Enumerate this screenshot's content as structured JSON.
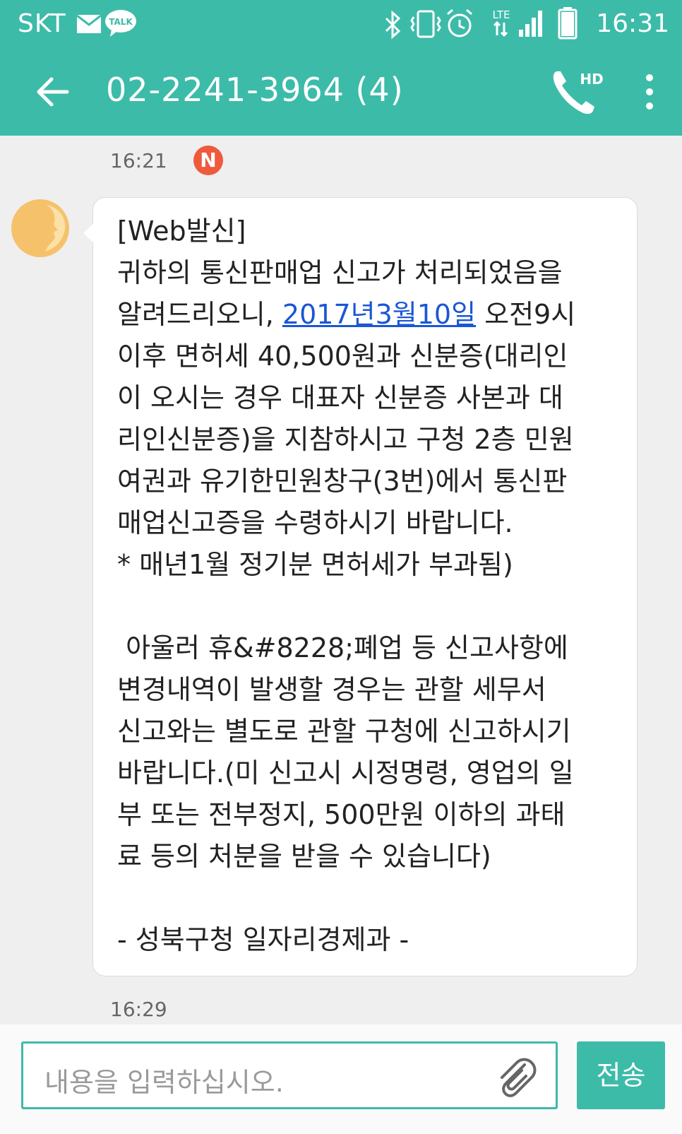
{
  "status_bar": {
    "carrier": "SKT",
    "talk_badge": "TALK",
    "network": "LTE",
    "time": "16:31",
    "icons": [
      "mail-icon",
      "talk-icon",
      "bluetooth-icon",
      "vibrate-icon",
      "alarm-icon",
      "lte-icon",
      "signal-icon",
      "battery-icon"
    ]
  },
  "app_bar": {
    "title": "02-2241-3964 (4)",
    "back_icon": "back-arrow-icon",
    "call_label": "HD",
    "call_icon": "phone-hd-icon",
    "menu_icon": "more-vert-icon"
  },
  "conversation": {
    "first_timestamp": "16:21",
    "new_badge": "N",
    "message": {
      "before_link": "[Web발신]\n귀하의 통신판매업 신고가 처리되었음을\n알려드리오니, ",
      "link_text": "2017년3월10일",
      "after_link": " 오전9시\n이후 면허세 40,500원과 신분증(대리인\n이 오시는 경우 대표자 신분증 사본과 대\n리인신분증)을 지참하시고 구청 2층 민원\n여권과 유기한민원창구(3번)에서 통신판\n매업신고증을 수령하시기 바랍니다.\n* 매년1월 정기분 면허세가 부과됨)\n\n 아울러 휴&#8228;폐업 등 신고사항에\n변경내역이 발생할 경우는 관할 세무서\n신고와는 별도로 관할 구청에 신고하시기\n바랍니다.(미 신고시 시정명령, 영업의 일\n부 또는 전부정지, 500만원 이하의 과태\n료 등의 처분을 받을 수 있습니다)\n\n- 성북구청 일자리경제과 -"
    },
    "second_timestamp": "16:29"
  },
  "composer": {
    "placeholder": "내용을 입력하십시오.",
    "attach_icon": "paperclip-icon",
    "send_label": "전송"
  },
  "colors": {
    "accent": "#3dbba9",
    "badge": "#ef5a3c",
    "link": "#1a56d6",
    "avatar": "#f5c26b"
  }
}
